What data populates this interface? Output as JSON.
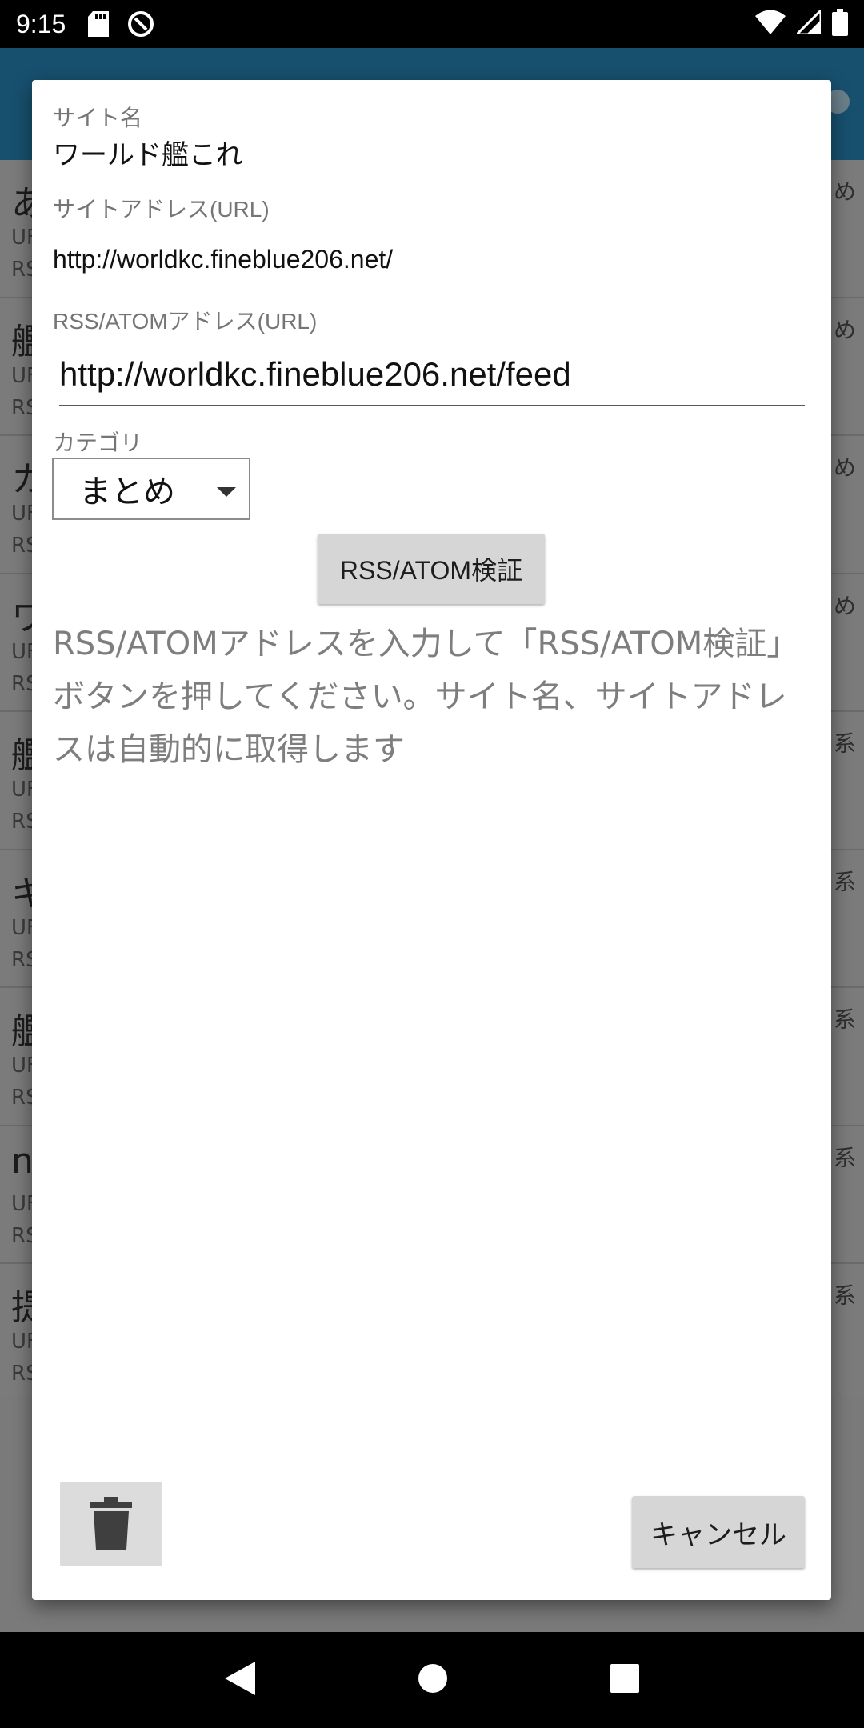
{
  "status_bar": {
    "time": "9:15",
    "icons": [
      "sd-card-icon",
      "data-saver-icon",
      "wifi-icon",
      "signal-icon",
      "battery-icon"
    ]
  },
  "background_list": {
    "items": [
      {
        "title": "あ",
        "url": "UF",
        "rss": "RS",
        "category": "め"
      },
      {
        "title": "艦",
        "url": "UF",
        "rss": "RS",
        "category": "め"
      },
      {
        "title": "カ",
        "url": "UF",
        "rss": "RS",
        "category": "め"
      },
      {
        "title": "ワ",
        "url": "UF",
        "rss": "RS",
        "category": "め"
      },
      {
        "title": "艦",
        "url": "UF",
        "rss": "RS",
        "category": "系"
      },
      {
        "title": "キ",
        "url": "UF",
        "rss": "RS",
        "category": "系"
      },
      {
        "title": "艦",
        "url": "UF",
        "rss": "RS",
        "category": "系"
      },
      {
        "title": "n",
        "url": "UF",
        "rss": "RS",
        "category": "系"
      },
      {
        "title": "提",
        "url": "UF",
        "rss": "RS",
        "category": "系"
      }
    ]
  },
  "dialog": {
    "site_name_label": "サイト名",
    "site_name_value": "ワールド艦これ",
    "site_url_label": "サイトアドレス(URL)",
    "site_url_value": "http://worldkc.fineblue206.net/",
    "rss_url_label": "RSS/ATOMアドレス(URL)",
    "rss_url_value": "http://worldkc.fineblue206.net/feed",
    "category_label": "カテゴリ",
    "category_value": "まとめ",
    "verify_button": "RSS/ATOM検証",
    "hint_text": "RSS/ATOMアドレスを入力して「RSS/ATOM検証」ボタンを押してください。サイト名、サイトアドレスは自動的に取得します",
    "cancel_button": "キャンセル"
  },
  "colors": {
    "app_bar": "#17506e",
    "scrim": "#7a7a7a",
    "button": "#d6d6d6"
  }
}
